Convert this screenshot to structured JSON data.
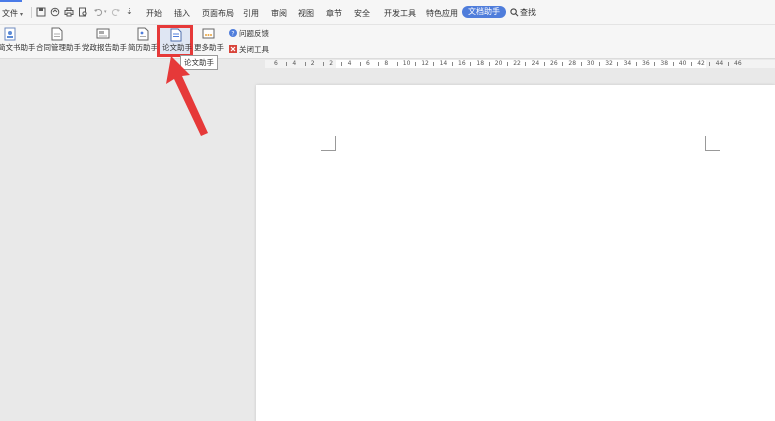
{
  "menubar": {
    "file_label": "文件",
    "tabs": [
      {
        "label": "开始",
        "active": false
      },
      {
        "label": "插入",
        "active": false
      },
      {
        "label": "页面布局",
        "active": false
      },
      {
        "label": "引用",
        "active": false
      },
      {
        "label": "审阅",
        "active": false
      },
      {
        "label": "视图",
        "active": false
      },
      {
        "label": "章节",
        "active": false
      },
      {
        "label": "安全",
        "active": false
      },
      {
        "label": "开发工具",
        "active": false
      },
      {
        "label": "特色应用",
        "active": false
      },
      {
        "label": "文档助手",
        "active": true
      }
    ],
    "search_label": "查找",
    "quick_access": [
      "save-icon",
      "export-pdf-icon",
      "print-icon",
      "print-preview-icon",
      "undo-icon",
      "redo-icon",
      "customize-icon"
    ]
  },
  "ribbon": {
    "buttons": [
      {
        "label": "简文书助手",
        "icon": "person-doc-icon"
      },
      {
        "label": "合同管理助手",
        "icon": "contract-doc-icon"
      },
      {
        "label": "党政报告助手",
        "icon": "report-doc-icon"
      },
      {
        "label": "简历助手",
        "icon": "resume-doc-icon"
      },
      {
        "label": "论文助手",
        "icon": "thesis-doc-icon",
        "highlighted": true
      },
      {
        "label": "更多助手",
        "icon": "more-assistants-icon"
      }
    ],
    "feedback_label": "问题反馈",
    "close_tool_label": "关闭工具"
  },
  "tooltip": {
    "text": "论文助手"
  },
  "ruler": {
    "labels": [
      "6",
      "4",
      "2",
      "2",
      "4",
      "6",
      "8",
      "10",
      "12",
      "14",
      "16",
      "18",
      "20",
      "22",
      "24",
      "26",
      "28",
      "30",
      "32",
      "34",
      "36",
      "38",
      "40",
      "42",
      "44",
      "46"
    ]
  },
  "colors": {
    "accent": "#4f7ddb",
    "highlight_box": "#e63939",
    "arrow": "#e63939"
  }
}
